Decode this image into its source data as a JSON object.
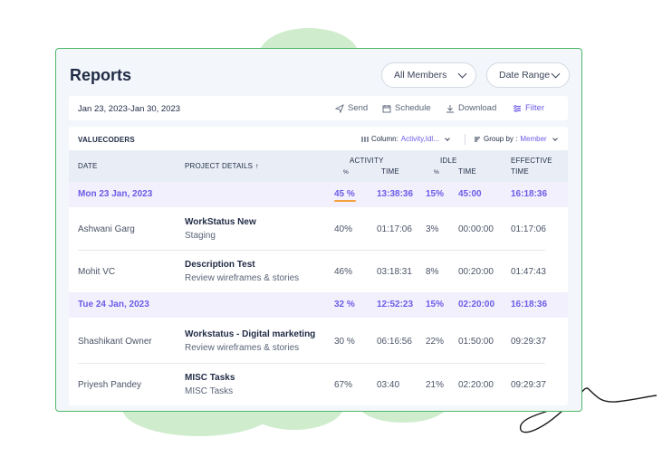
{
  "header": {
    "title": "Reports",
    "members_dropdown": "All Members",
    "date_range_dropdown": "Date Range"
  },
  "toolbar": {
    "range": "Jan 23, 2023-Jan 30, 2023",
    "send": "Send",
    "schedule": "Schedule",
    "download": "Download",
    "filter": "Filter"
  },
  "table": {
    "company": "VALUECODERS",
    "column_label": "Column:",
    "column_value": "Activity,Idl...",
    "groupby_label": "Group by :",
    "groupby_value": "Member",
    "headers": {
      "date": "DATE",
      "project": "PROJECT DETAILS ↑",
      "activity": "ACTIVITY",
      "activity_pct": "%",
      "activity_time": "TIME",
      "idle": "IDLE",
      "idle_pct": "%",
      "idle_time": "TIME",
      "effective": "EFFECTIVE",
      "effective_time": "TIME"
    },
    "day1": {
      "date": "Mon 23 Jan, 2023",
      "activity_pct": "45 %",
      "activity_time": "13:38:36",
      "idle_pct": "15%",
      "idle_time": "45:00",
      "effective_time": "16:18:36"
    },
    "day1_rows": [
      {
        "member": "Ashwani Garg",
        "project": "WorkStatus New",
        "task": "Staging",
        "activity_pct": "40%",
        "activity_time": "01:17:06",
        "idle_pct": "3%",
        "idle_time": "00:00:00",
        "effective_time": "01:17:06"
      },
      {
        "member": "Mohit VC",
        "project": "Description Test",
        "task": "Review wireframes & stories",
        "activity_pct": "46%",
        "activity_time": "03:18:31",
        "idle_pct": "8%",
        "idle_time": "00:20:00",
        "effective_time": "01:47:43"
      }
    ],
    "day2": {
      "date": "Tue 24 Jan, 2023",
      "activity_pct": "32 %",
      "activity_time": "12:52:23",
      "idle_pct": "15%",
      "idle_time": "02:20:00",
      "effective_time": "16:18:36"
    },
    "day2_rows": [
      {
        "member": "Shashikant Owner",
        "project": "Workstatus - Digital marketing",
        "task": "Review wireframes & stories",
        "activity_pct": "30 %",
        "activity_time": "06:16:56",
        "idle_pct": "22%",
        "idle_time": "01:50:00",
        "effective_time": "09:29:37"
      },
      {
        "member": "Priyesh Pandey",
        "project": "MISC Tasks",
        "task": "MISC Tasks",
        "activity_pct": "67%",
        "activity_time": "03:40",
        "idle_pct": "21%",
        "idle_time": "02:20:00",
        "effective_time": "09:29:37"
      }
    ]
  },
  "colors": {
    "accent": "#6c5ce7",
    "highlight": "#f2a13c",
    "border": "#4fb86a",
    "decor": "#cfeccd"
  }
}
